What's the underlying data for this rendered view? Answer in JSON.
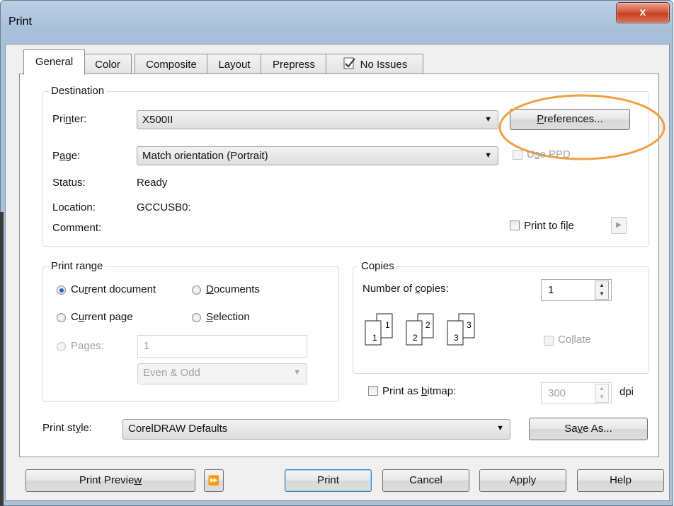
{
  "window": {
    "title": "Print",
    "close_glyph": "x"
  },
  "tabs": [
    {
      "label": "General"
    },
    {
      "label": "Color"
    },
    {
      "label": "Composite"
    },
    {
      "label": "Layout"
    },
    {
      "label": "Prepress"
    },
    {
      "label": "No Issues",
      "icon": "check-doc-icon"
    }
  ],
  "destination": {
    "group_label": "Destination",
    "printer_label": "Printer:",
    "printer_value": "X500II",
    "preferences_label": "Preferences...",
    "page_label": "Page:",
    "page_value": "Match orientation (Portrait)",
    "use_ppd_label": "Use PPD",
    "status_label": "Status:",
    "status_value": "Ready",
    "location_label": "Location:",
    "location_value": "GCCUSB0:",
    "comment_label": "Comment:",
    "print_to_file_label": "Print to file"
  },
  "print_range": {
    "group_label": "Print range",
    "current_document": "Current document",
    "documents": "Documents",
    "current_page": "Current page",
    "selection": "Selection",
    "pages_label": "Pages:",
    "pages_value": "1",
    "even_odd_value": "Even & Odd"
  },
  "copies": {
    "group_label": "Copies",
    "number_label": "Number of copies:",
    "number_value": "1",
    "collate_label": "Collate",
    "page_icons": [
      "1",
      "1",
      "2",
      "2",
      "3",
      "3"
    ]
  },
  "bitmap": {
    "label": "Print as bitmap:",
    "dpi_value": "300",
    "dpi_unit": "dpi"
  },
  "print_style": {
    "label": "Print style:",
    "value": "CorelDRAW Defaults",
    "save_as_label": "Save As..."
  },
  "footer": {
    "print_preview": "Print Preview",
    "print": "Print",
    "cancel": "Cancel",
    "apply": "Apply",
    "help": "Help"
  },
  "annotation": {
    "highlight_color": "#f0a040"
  }
}
